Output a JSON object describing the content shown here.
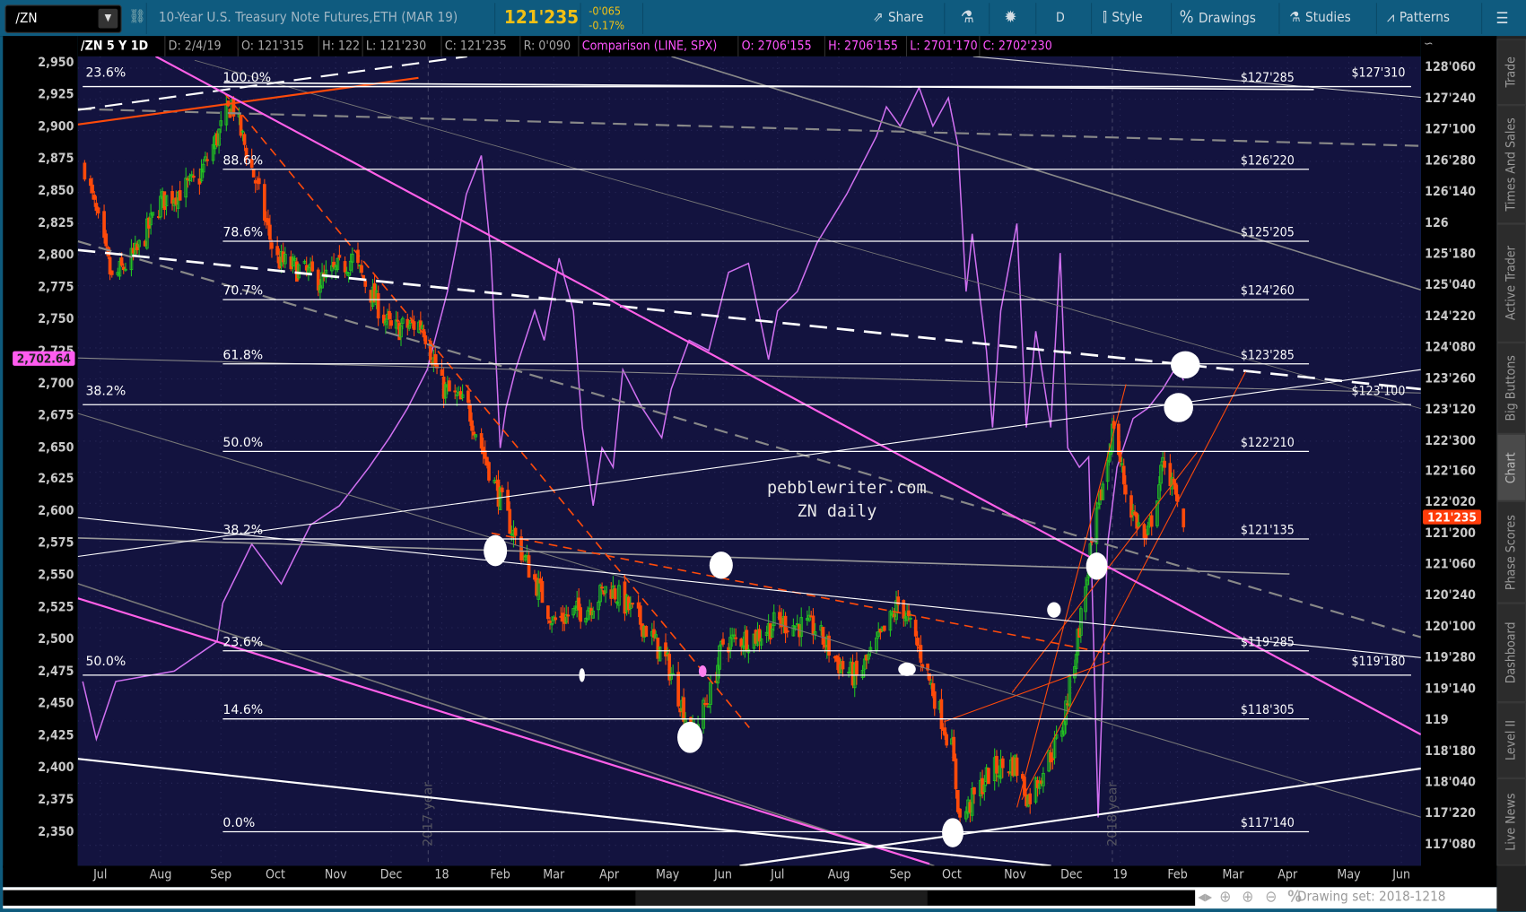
{
  "toolbar": {
    "symbol": "/ZN",
    "title": "10-Year U.S. Treasury Note Futures,ETH (MAR 19)",
    "last": "121'235",
    "change": "-0'065",
    "change_pct": "-0.17%",
    "share": "Share",
    "period": "D",
    "style": "Style",
    "drawings": "Drawings",
    "studies": "Studies",
    "patterns": "Patterns"
  },
  "info_bar": {
    "symbol_period": "/ZN 5 Y 1D",
    "date": "D: 2/4/19",
    "open": "O: 121'315",
    "high": "H: 122",
    "low": "L: 121'230",
    "close": "C: 121'235",
    "range": "R: 0'090",
    "comparison": "Comparison (LINE, SPX)",
    "cmp_open": "O: 2706'155",
    "cmp_high": "H: 2706'155",
    "cmp_low": "L: 2701'170",
    "cmp_close": "C: 2702'230"
  },
  "chart_data": {
    "type": "candlestick",
    "colors": {
      "up": "#22c022",
      "down": "#ff4a0a",
      "comparison": "#d070f0",
      "background": "#13133f"
    },
    "x_ticks": [
      "Jul",
      "Aug",
      "Sep",
      "Oct",
      "Nov",
      "Dec",
      "18",
      "Feb",
      "Mar",
      "Apr",
      "May",
      "Jun",
      "Jul",
      "Aug",
      "Sep",
      "Oct",
      "Nov",
      "Dec",
      "19",
      "Feb",
      "Mar",
      "Apr",
      "May",
      "Jun"
    ],
    "right_axis_ticks": [
      "128'060",
      "127'240",
      "127'100",
      "126'280",
      "126'140",
      "126",
      "125'180",
      "125'040",
      "124'220",
      "124'080",
      "123'260",
      "123'120",
      "122'300",
      "122'160",
      "122'020",
      "121'200",
      "121'060",
      "120'240",
      "120'100",
      "119'280",
      "119'140",
      "119",
      "118'180",
      "118'040",
      "117'220",
      "117'080"
    ],
    "left_axis_ticks": [
      "2,950",
      "2,925",
      "2,900",
      "2,875",
      "2,850",
      "2,825",
      "2,800",
      "2,775",
      "2,750",
      "2,725",
      "2,700",
      "2,675",
      "2,650",
      "2,625",
      "2,600",
      "2,575",
      "2,550",
      "2,525",
      "2,500",
      "2,475",
      "2,450",
      "2,425",
      "2,400",
      "2,375",
      "2,350"
    ],
    "current_price_tag": "121'235",
    "comparison_price_tag": "2,702.64",
    "year_markers": [
      "2017 year",
      "2018 year"
    ],
    "watermark": [
      "pebblewriter.com",
      "ZN daily"
    ],
    "zn_close_path": [
      [
        "2017-06-23",
        126.8
      ],
      [
        "2017-07-07",
        125.2
      ],
      [
        "2017-07-20",
        125.6
      ],
      [
        "2017-08-01",
        126.3
      ],
      [
        "2017-08-20",
        126.6
      ],
      [
        "2017-09-07",
        127.7
      ],
      [
        "2017-09-20",
        126.6
      ],
      [
        "2017-10-01",
        125.5
      ],
      [
        "2017-10-25",
        125.2
      ],
      [
        "2017-11-10",
        125.5
      ],
      [
        "2017-12-01",
        124.5
      ],
      [
        "2017-12-20",
        124.6
      ],
      [
        "2018-01-01",
        123.7
      ],
      [
        "2018-01-15",
        123.4
      ],
      [
        "2018-01-28",
        122.4
      ],
      [
        "2018-02-10",
        121.5
      ],
      [
        "2018-03-01",
        120.4
      ],
      [
        "2018-03-20",
        120.6
      ],
      [
        "2018-04-01",
        120.9
      ],
      [
        "2018-04-20",
        120.3
      ],
      [
        "2018-05-01",
        119.8
      ],
      [
        "2018-05-15",
        118.8
      ],
      [
        "2018-05-25",
        119.4
      ],
      [
        "2018-06-01",
        120.1
      ],
      [
        "2018-06-20",
        120.2
      ],
      [
        "2018-07-01",
        120.4
      ],
      [
        "2018-07-20",
        120.3
      ],
      [
        "2018-08-01",
        119.8
      ],
      [
        "2018-08-10",
        119.6
      ],
      [
        "2018-08-25",
        120.3
      ],
      [
        "2018-09-01",
        120.7
      ],
      [
        "2018-09-15",
        119.8
      ],
      [
        "2018-10-01",
        118.6
      ],
      [
        "2018-10-05",
        117.6
      ],
      [
        "2018-10-20",
        118.3
      ],
      [
        "2018-11-01",
        118.4
      ],
      [
        "2018-11-08",
        117.9
      ],
      [
        "2018-11-25",
        118.8
      ],
      [
        "2018-12-01",
        119.6
      ],
      [
        "2018-12-12",
        121.2
      ],
      [
        "2018-12-28",
        123.2
      ],
      [
        "2019-01-05",
        122.1
      ],
      [
        "2019-01-15",
        121.5
      ],
      [
        "2019-01-25",
        122.7
      ],
      [
        "2019-02-04",
        121.73
      ]
    ],
    "spx_comparison": [
      [
        "2017-06-22",
        2468
      ],
      [
        "2017-06-29",
        2423
      ],
      [
        "2017-07-09",
        2468
      ],
      [
        "2017-08-08",
        2476
      ],
      [
        "2017-08-30",
        2499
      ],
      [
        "2017-09-02",
        2529
      ],
      [
        "2017-09-18",
        2575
      ],
      [
        "2017-10-04",
        2544
      ],
      [
        "2017-10-19",
        2590
      ],
      [
        "2017-11-03",
        2605
      ],
      [
        "2017-11-19",
        2635
      ],
      [
        "2017-11-30",
        2658
      ],
      [
        "2017-12-11",
        2681
      ],
      [
        "2017-12-23",
        2711
      ],
      [
        "2018-01-04",
        2772
      ],
      [
        "2018-01-14",
        2848
      ],
      [
        "2018-01-22",
        2878
      ],
      [
        "2018-01-27",
        2802
      ],
      [
        "2018-02-01",
        2650
      ],
      [
        "2018-02-04",
        2681
      ],
      [
        "2018-02-09",
        2711
      ],
      [
        "2018-02-19",
        2757
      ],
      [
        "2018-02-24",
        2734
      ],
      [
        "2018-03-04",
        2798
      ],
      [
        "2018-03-12",
        2757
      ],
      [
        "2018-03-17",
        2666
      ],
      [
        "2018-03-23",
        2605
      ],
      [
        "2018-03-28",
        2650
      ],
      [
        "2018-04-03",
        2635
      ],
      [
        "2018-04-08",
        2711
      ],
      [
        "2018-04-18",
        2681
      ],
      [
        "2018-04-28",
        2658
      ],
      [
        "2018-05-03",
        2696
      ],
      [
        "2018-05-13",
        2734
      ],
      [
        "2018-05-24",
        2726
      ],
      [
        "2018-06-04",
        2787
      ],
      [
        "2018-06-15",
        2794
      ],
      [
        "2018-06-26",
        2719
      ],
      [
        "2018-07-01",
        2757
      ],
      [
        "2018-07-11",
        2772
      ],
      [
        "2018-07-21",
        2810
      ],
      [
        "2018-08-05",
        2848
      ],
      [
        "2018-08-10",
        2863
      ],
      [
        "2018-08-20",
        2893
      ],
      [
        "2018-08-25",
        2916
      ],
      [
        "2018-09-01",
        2901
      ],
      [
        "2018-09-12",
        2931
      ],
      [
        "2018-09-20",
        2901
      ],
      [
        "2018-09-29",
        2923
      ],
      [
        "2018-10-04",
        2886
      ],
      [
        "2018-10-08",
        2772
      ],
      [
        "2018-10-11",
        2817
      ],
      [
        "2018-10-18",
        2726
      ],
      [
        "2018-10-21",
        2666
      ],
      [
        "2018-10-25",
        2757
      ],
      [
        "2018-11-02",
        2825
      ],
      [
        "2018-11-07",
        2666
      ],
      [
        "2018-11-12",
        2741
      ],
      [
        "2018-11-20",
        2666
      ],
      [
        "2018-11-25",
        2802
      ],
      [
        "2018-11-29",
        2650
      ],
      [
        "2018-12-06",
        2635
      ],
      [
        "2018-12-12",
        2643
      ],
      [
        "2018-12-18",
        2362
      ],
      [
        "2018-12-24",
        2575
      ],
      [
        "2018-12-30",
        2635
      ],
      [
        "2019-01-08",
        2673
      ],
      [
        "2019-01-16",
        2681
      ],
      [
        "2019-01-24",
        2696
      ],
      [
        "2019-02-01",
        2715
      ],
      [
        "2019-02-04",
        2702.64
      ]
    ],
    "fib_set_a": [
      {
        "pct": "100.0%",
        "price": "$127'285"
      },
      {
        "pct": "88.6%",
        "price": "$126'220"
      },
      {
        "pct": "78.6%",
        "price": "$125'205"
      },
      {
        "pct": "70.7%",
        "price": "$124'260"
      },
      {
        "pct": "61.8%",
        "price": "$123'285"
      },
      {
        "pct": "50.0%",
        "price": "$122'210"
      },
      {
        "pct": "38.2%",
        "price": "$121'135"
      },
      {
        "pct": "23.6%",
        "price": "$119'285"
      },
      {
        "pct": "14.6%",
        "price": "$118'305"
      },
      {
        "pct": "0.0%",
        "price": "$117'140"
      }
    ],
    "fib_set_b": [
      {
        "pct": "23.6%",
        "price": "$127'310"
      },
      {
        "pct": "38.2%",
        "price": "$123'100"
      },
      {
        "pct": "50.0%",
        "price": "$119'180"
      }
    ]
  },
  "sidebar": {
    "tabs": [
      "Trade",
      "Times And Sales",
      "Active Trader",
      "Big Buttons",
      "Chart",
      "Phase Scores",
      "Dashboard",
      "Level II",
      "Live News"
    ],
    "active": "Chart"
  },
  "footer": {
    "drawing_set": "Drawing set: 2018-1218"
  }
}
